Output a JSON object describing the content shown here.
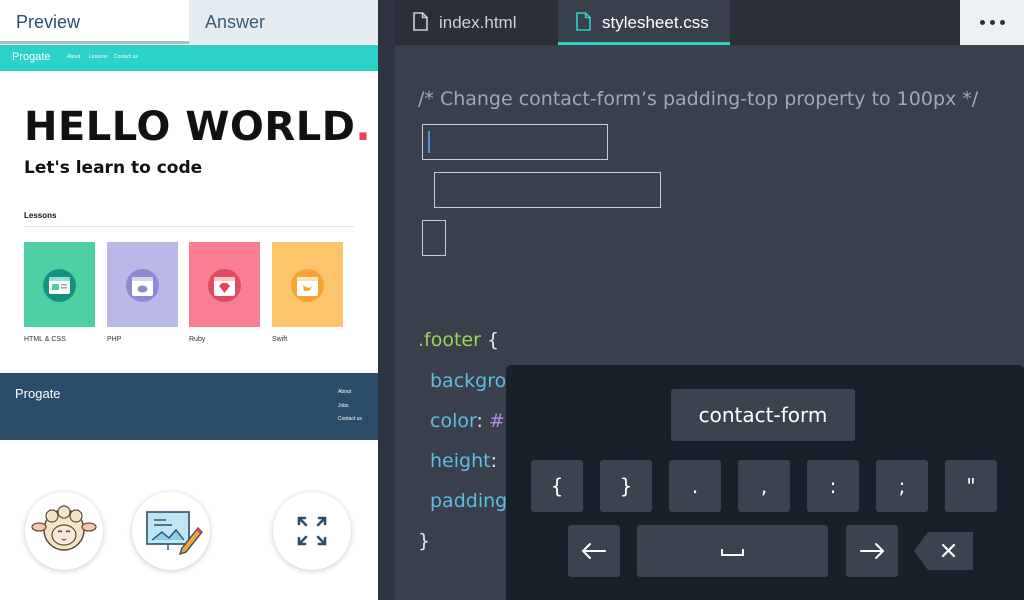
{
  "left_tabs": {
    "preview": "Preview",
    "answer": "Answer"
  },
  "site": {
    "logo": "Progate",
    "nav": [
      "About",
      "Lessons",
      "Contact us"
    ],
    "hello": "HELLO WORLD",
    "hello_dot": ".",
    "subtitle": "Let's learn to code",
    "lessons_heading": "Lessons",
    "lessons": [
      {
        "label": "HTML & CSS",
        "color": "#4ed0a4"
      },
      {
        "label": "PHP",
        "color": "#b9b8e6"
      },
      {
        "label": "Ruby",
        "color": "#f87f93"
      },
      {
        "label": "Swift",
        "color": "#fcc56c"
      }
    ],
    "footer_logo": "Progate",
    "footer_links": [
      "About",
      "Jobs",
      "Contact us"
    ]
  },
  "bottom_buttons": [
    "sheep-avatar-icon",
    "slide-edit-icon",
    "expand-icon"
  ],
  "editor": {
    "tabs": [
      {
        "name": "index.html",
        "active": false
      },
      {
        "name": "stylesheet.css",
        "active": true
      }
    ],
    "more_icon": "more-dots-icon",
    "comment": "/* Change contact-form’s padding-top property to 100px */",
    "footer_selector": ".footer",
    "open_brace": "{",
    "close_brace": "}",
    "props": [
      {
        "name": "backgro",
        "rest": ""
      },
      {
        "name": "color",
        "rest": ": #"
      },
      {
        "name": "height",
        "rest": ":"
      },
      {
        "name": "padding",
        "rest": ""
      }
    ]
  },
  "keyboard": {
    "suggestion": "contact-form",
    "symbols": [
      "{",
      "}",
      ".",
      ",",
      ":",
      ";",
      "\""
    ],
    "nav_keys": [
      "left-arrow-icon",
      "space-icon",
      "right-arrow-icon",
      "backspace-icon"
    ]
  },
  "colors": {
    "accent_teal": "#2bd2c8",
    "footer_navy": "#2c4d6a",
    "editor_bg": "#393f4b",
    "selector_green": "#9dd452",
    "property_blue": "#5bc0de",
    "dot_red": "#e8425a"
  }
}
